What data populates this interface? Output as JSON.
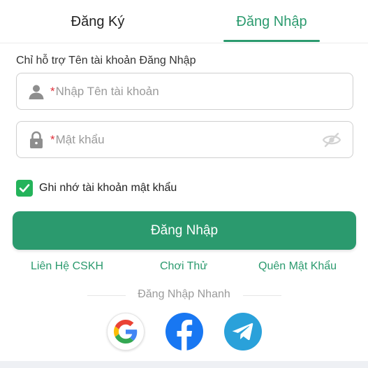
{
  "tabs": {
    "register": "Đăng Ký",
    "login": "Đăng Nhập",
    "active": "login"
  },
  "form": {
    "hint": "Chỉ hỗ trợ Tên tài khoản Đăng Nhập",
    "username": {
      "required_mark": "*",
      "placeholder": "Nhập Tên tài khoản"
    },
    "password": {
      "required_mark": "*",
      "placeholder": "Mật khẩu"
    },
    "remember": {
      "label": "Ghi nhớ tài khoản mật khẩu",
      "checked": true
    },
    "submit_label": "Đăng Nhập"
  },
  "links": {
    "support": "Liên Hệ CSKH",
    "try": "Chơi Thử",
    "forgot": "Quên Mật Khẩu"
  },
  "quick_login": {
    "label": "Đăng Nhập Nhanh",
    "providers": [
      "google-icon",
      "facebook-icon",
      "telegram-icon"
    ]
  },
  "colors": {
    "accent": "#2b9a6e",
    "checkbox": "#24b35a",
    "required": "#e0303a",
    "facebook": "#1877f2",
    "telegram": "#2aa1da"
  }
}
